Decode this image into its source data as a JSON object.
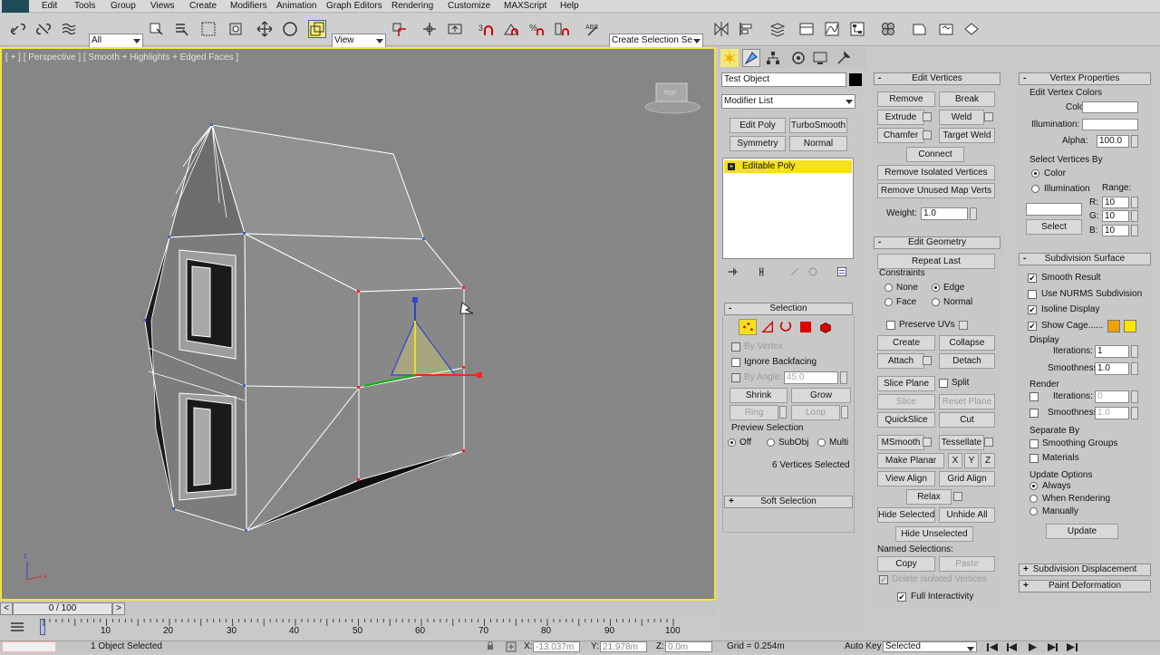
{
  "menu": {
    "items": [
      "Edit",
      "Tools",
      "Group",
      "Views",
      "Create",
      "Modifiers",
      "Animation",
      "Graph Editors",
      "Rendering",
      "Customize",
      "MAXScript",
      "Help"
    ]
  },
  "toolbar": {
    "filter_value": "All",
    "refcoord_value": "View",
    "selection_set_value": "Create Selection Se"
  },
  "viewport": {
    "label": "[ + ] [ Perspective ] [ Smooth + Highlights + Edged Faces ]",
    "viewcube_label": "TOP",
    "axis_x": "x",
    "axis_z": "z"
  },
  "command_panel": {
    "object_name": "Test Object",
    "modifier_list": "Modifier List",
    "modifier_buttons": [
      "Edit Poly",
      "TurboSmooth",
      "Symmetry",
      "Normal"
    ],
    "stack_item": "Editable Poly",
    "selection": {
      "title": "Selection",
      "by_vertex": "By Vertex",
      "ignore_backfacing": "Ignore Backfacing",
      "by_angle": "By Angle:",
      "angle_value": "45.0",
      "shrink": "Shrink",
      "grow": "Grow",
      "ring": "Ring",
      "loop": "Loop",
      "preview_selection": "Preview Selection",
      "preview_options": [
        "Off",
        "SubObj",
        "Multi"
      ],
      "status": "6 Vertices Selected"
    },
    "soft_selection": "Soft Selection"
  },
  "edit_vertices": {
    "title": "Edit Vertices",
    "remove": "Remove",
    "break": "Break",
    "extrude": "Extrude",
    "weld": "Weld",
    "chamfer": "Chamfer",
    "target_weld": "Target Weld",
    "connect": "Connect",
    "remove_isolated": "Remove Isolated Vertices",
    "remove_unused": "Remove Unused Map Verts",
    "weight_label": "Weight:",
    "weight_value": "1.0"
  },
  "edit_geometry": {
    "title": "Edit Geometry",
    "repeat_last": "Repeat Last",
    "constraints": "Constraints",
    "none": "None",
    "edge": "Edge",
    "face": "Face",
    "normal": "Normal",
    "preserve_uvs": "Preserve UVs",
    "create": "Create",
    "collapse": "Collapse",
    "attach": "Attach",
    "detach": "Detach",
    "slice_plane": "Slice Plane",
    "split": "Split",
    "slice": "Slice",
    "reset_plane": "Reset Plane",
    "quickslice": "QuickSlice",
    "cut": "Cut",
    "msmooth": "MSmooth",
    "tessellate": "Tessellate",
    "make_planar": "Make Planar",
    "x": "X",
    "y": "Y",
    "z": "Z",
    "view_align": "View Align",
    "grid_align": "Grid Align",
    "relax": "Relax",
    "hide_selected": "Hide Selected",
    "unhide_all": "Unhide All",
    "hide_unselected": "Hide Unselected",
    "named_selections": "Named Selections:",
    "copy": "Copy",
    "paste": "Paste",
    "delete_isolated": "Delete Isolated Vertices",
    "full_interactivity": "Full Interactivity"
  },
  "vertex_properties": {
    "title": "Vertex Properties",
    "edit_vertex_colors": "Edit Vertex Colors",
    "color": "Color:",
    "illumination": "Illumination:",
    "alpha": "Alpha:",
    "alpha_value": "100.0",
    "select_vertices_by": "Select Vertices By",
    "opt_color": "Color",
    "opt_illumination": "Illumination",
    "range": "Range:",
    "r": "R:",
    "g": "G:",
    "b": "B:",
    "r_value": "10",
    "g_value": "10",
    "b_value": "10",
    "select": "Select"
  },
  "subdivision_surface": {
    "title": "Subdivision Surface",
    "smooth_result": "Smooth Result",
    "use_nurms": "Use NURMS Subdivision",
    "isoline_display": "Isoline Display",
    "show_cage": "Show Cage......",
    "display": "Display",
    "iterations": "Iterations:",
    "iterations_value": "1",
    "smoothness": "Smoothness:",
    "smoothness_value": "1.0",
    "render": "Render",
    "render_iterations_value": "0",
    "render_smoothness_value": "1.0",
    "separate_by": "Separate By",
    "smoothing_groups": "Smoothing Groups",
    "materials": "Materials",
    "update_options": "Update Options",
    "always": "Always",
    "when_rendering": "When Rendering",
    "manually": "Manually",
    "update": "Update",
    "subdivision_displacement": "Subdivision Displacement",
    "paint_deformation": "Paint Deformation"
  },
  "timeline": {
    "frame": "0 / 100",
    "ticks": [
      "10",
      "20",
      "30",
      "40",
      "50",
      "60",
      "70",
      "80",
      "90",
      "100"
    ]
  },
  "status": {
    "objects": "1 Object Selected",
    "x_label": "X:",
    "x_value": "-13.037m",
    "y_label": "Y:",
    "y_value": "21.978m",
    "z_label": "Z:",
    "z_value": "0.0m",
    "grid": "Grid = 0.254m",
    "auto_key": "Auto Key",
    "key_mode": "Selected"
  },
  "colors": {
    "viewport_bg": "#868686",
    "viewport_border": "#f3e43b",
    "wire": "#ffffff",
    "selected_vertex": "#ff2020",
    "cage_orange": "#f2a100",
    "cage_yellow": "#ffe600",
    "stack_highlight": "#f5e020"
  }
}
